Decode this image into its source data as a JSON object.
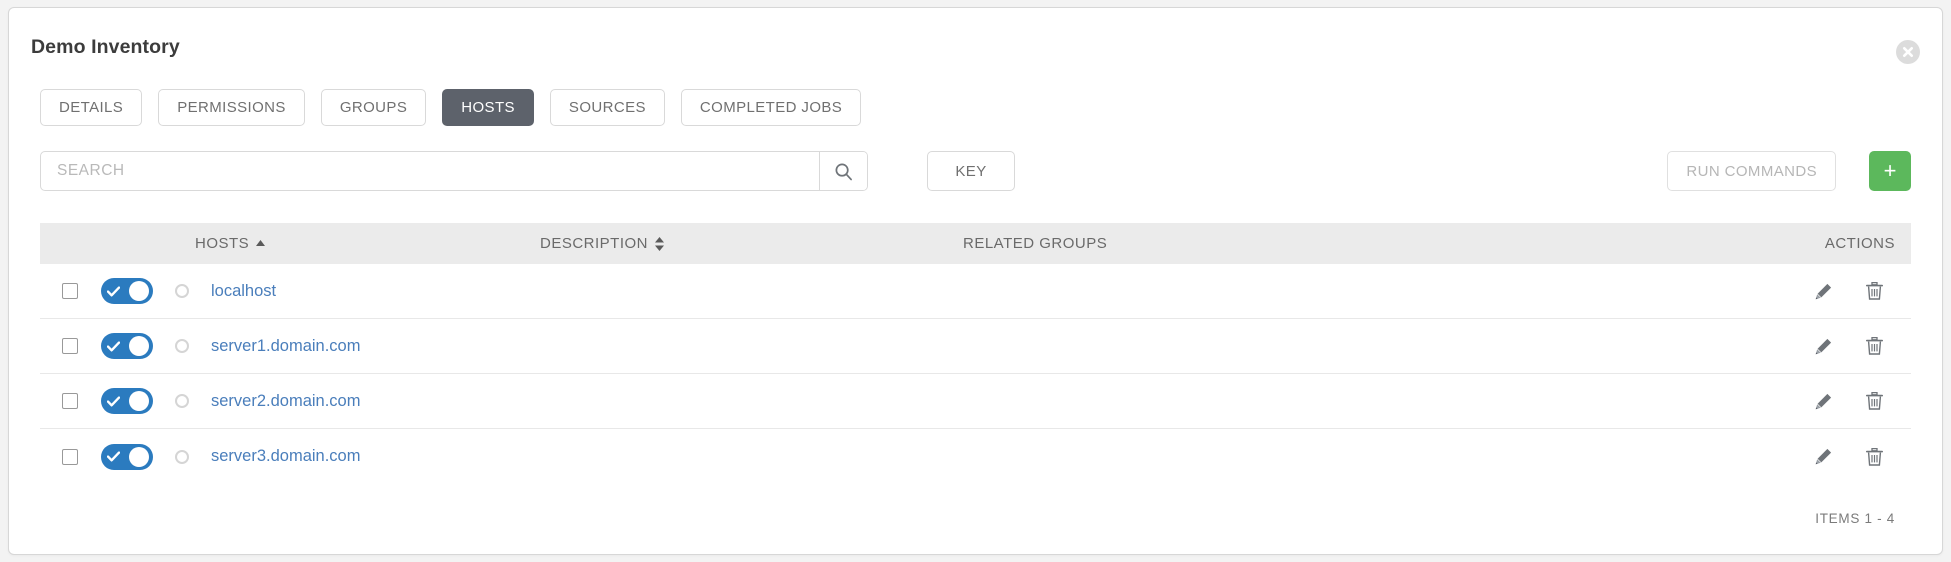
{
  "window": {
    "title": "Demo Inventory",
    "close_label": "×"
  },
  "tabs": [
    {
      "label": "DETAILS",
      "active": false
    },
    {
      "label": "PERMISSIONS",
      "active": false
    },
    {
      "label": "GROUPS",
      "active": false
    },
    {
      "label": "HOSTS",
      "active": true
    },
    {
      "label": "SOURCES",
      "active": false
    },
    {
      "label": "COMPLETED JOBS",
      "active": false
    }
  ],
  "toolbar": {
    "search_placeholder": "SEARCH",
    "search_value": "",
    "search_icon": "search-icon",
    "key_label": "KEY",
    "run_commands_label": "RUN COMMANDS",
    "run_commands_disabled": true,
    "add_label": "+",
    "add_color": "#5cb85c"
  },
  "table": {
    "columns": [
      {
        "label": "HOSTS",
        "sort": "asc",
        "align": "left"
      },
      {
        "label": "DESCRIPTION",
        "sort": "both",
        "align": "left"
      },
      {
        "label": "RELATED GROUPS",
        "sort": "none",
        "align": "left"
      },
      {
        "label": "ACTIONS",
        "sort": "none",
        "align": "right"
      }
    ],
    "rows": [
      {
        "selected": false,
        "enabled": true,
        "status": "none",
        "host": "localhost",
        "description": "",
        "related_groups": ""
      },
      {
        "selected": false,
        "enabled": true,
        "status": "none",
        "host": "server1.domain.com",
        "description": "",
        "related_groups": ""
      },
      {
        "selected": false,
        "enabled": true,
        "status": "none",
        "host": "server2.domain.com",
        "description": "",
        "related_groups": ""
      },
      {
        "selected": false,
        "enabled": true,
        "status": "none",
        "host": "server3.domain.com",
        "description": "",
        "related_groups": ""
      }
    ],
    "row_actions": [
      {
        "name": "edit-icon",
        "title": "Edit"
      },
      {
        "name": "delete-icon",
        "title": "Delete"
      }
    ]
  },
  "footer": {
    "items_label": "ITEMS  1 - 4"
  },
  "colors": {
    "active_tab_bg": "#5d626b",
    "toggle_on": "#2b7bbf",
    "link": "#4a7ebb",
    "add_button": "#5cb85c",
    "header_bg": "#ebebeb"
  }
}
